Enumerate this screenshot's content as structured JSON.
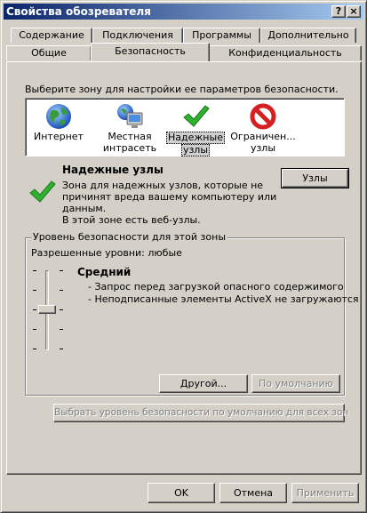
{
  "window": {
    "title": "Свойства обозревателя",
    "help_button": "?",
    "close_button": "×"
  },
  "tabs_back": [
    "Содержание",
    "Подключения",
    "Программы",
    "Дополнительно"
  ],
  "tabs_front": [
    "Общие",
    "Безопасность",
    "Конфиденциальность"
  ],
  "active_tab": "Безопасность",
  "zones": {
    "prompt": "Выберите зону для настройки ее параметров безопасности.",
    "items": [
      {
        "line1": "Интернет",
        "line2": "",
        "icon": "globe-icon"
      },
      {
        "line1": "Местная",
        "line2": "интрасеть",
        "icon": "intranet-icon"
      },
      {
        "line1": "Надежные",
        "line2": "узлы",
        "icon": "checkmark-icon",
        "selected": true
      },
      {
        "line1": "Ограничен...",
        "line2": "узлы",
        "icon": "restricted-icon"
      }
    ]
  },
  "zone_info": {
    "title": "Надежные узлы",
    "desc1": "Зона для надежных узлов, которые не",
    "desc2": "причинят вреда вашему компьютеру или",
    "desc3": "данным.",
    "desc4": "В этой зоне есть веб-узлы.",
    "sites_button": "Узлы"
  },
  "security_level": {
    "group_title": "Уровень безопасности для этой зоны",
    "allowed": "Разрешенные уровни: любые",
    "level_name": "Средний",
    "bullet1": "- Запрос перед загрузкой опасного содержимого",
    "bullet2": "- Неподписанные элементы ActiveX не загружаются",
    "slider_level": "Средний",
    "custom_button": "Другой...",
    "default_button": "По умолчанию"
  },
  "reset_all_button": "Выбрать уровень безопасности по умолчанию для всех зон",
  "footer": {
    "ok": "OK",
    "cancel": "Отмена",
    "apply": "Применить"
  },
  "colors": {
    "title_start": "#0a246a",
    "title_end": "#a6caf0",
    "face": "#d4d0c8",
    "check_green": "#2fb02f",
    "restricted_red": "#d42020",
    "globe_blue": "#2a6fd6"
  }
}
